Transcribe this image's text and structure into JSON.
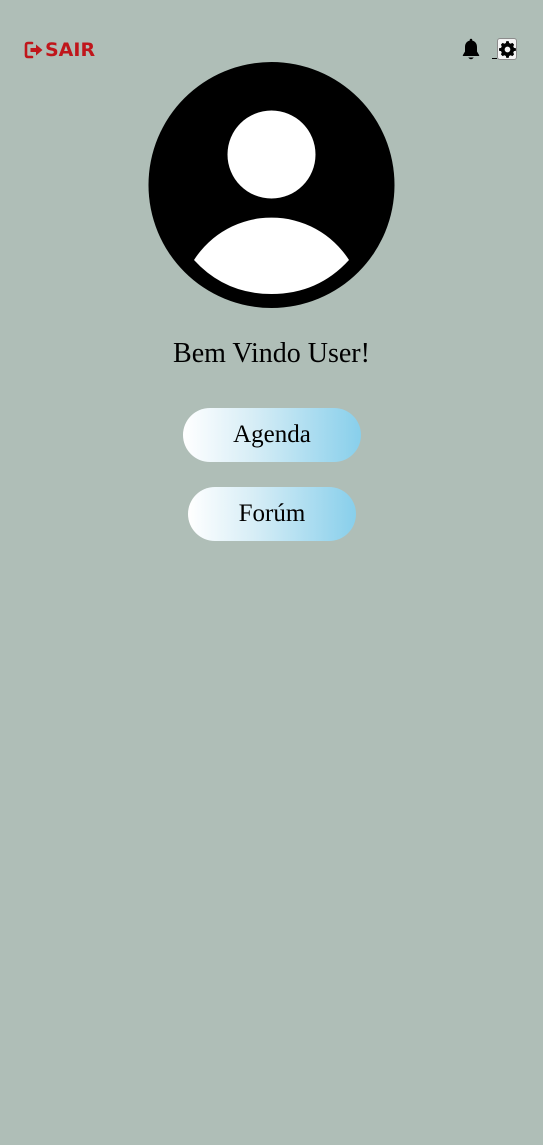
{
  "header": {
    "logout_label": "SAIR",
    "logout_color": "#c0161b"
  },
  "icons": {
    "logout": "logout-arrow-icon",
    "notifications": "bell-icon",
    "settings": "gear-icon",
    "avatar": "user-avatar-icon"
  },
  "main": {
    "welcome_text": "Bem Vindo User!",
    "buttons": [
      {
        "label": "Agenda"
      },
      {
        "label": "Forúm"
      }
    ]
  },
  "colors": {
    "background": "#afbeb7",
    "button_gradient_start": "#ffffff",
    "button_gradient_end": "#88cfeb"
  }
}
